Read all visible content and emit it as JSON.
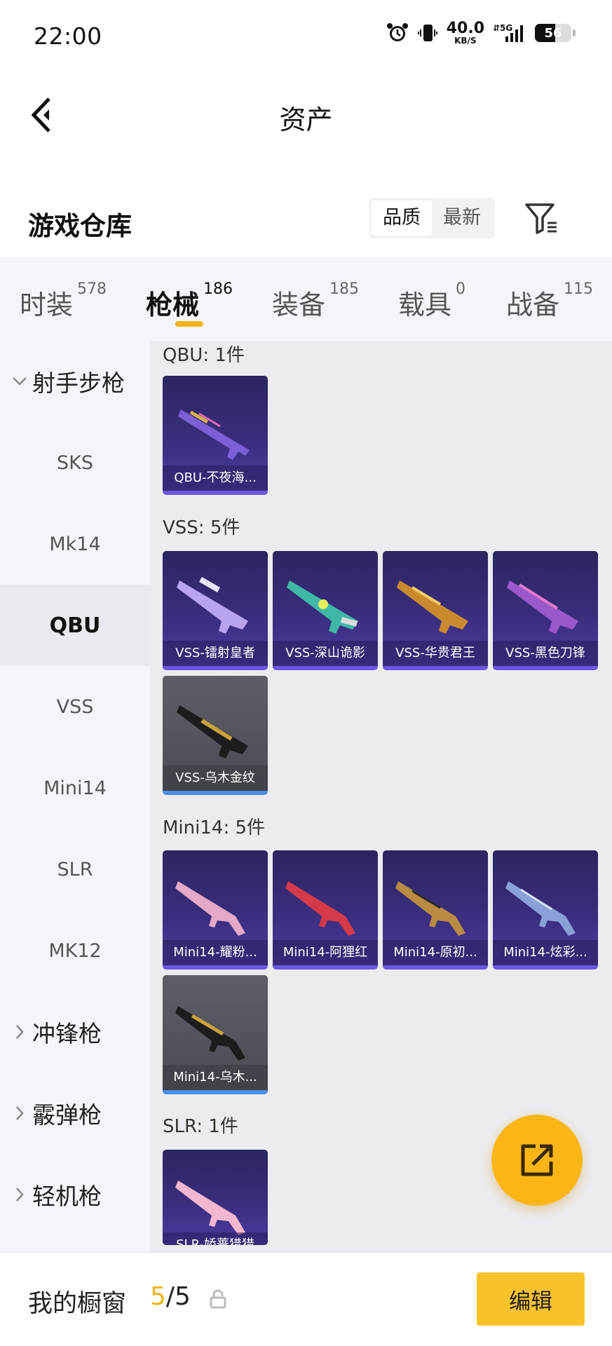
{
  "status_bar": {
    "time": "22:00",
    "net_speed": "40.0",
    "net_unit": "KB/S",
    "network": "5G",
    "battery": "56",
    "battery_level": 0.56
  },
  "nav": {
    "title": "资产"
  },
  "warehouse": {
    "title": "游戏仓库",
    "sort_options": [
      "品质",
      "最新"
    ],
    "active_sort": "品质"
  },
  "tabs": [
    {
      "label": "时装",
      "count": "578"
    },
    {
      "label": "枪械",
      "count": "186"
    },
    {
      "label": "装备",
      "count": "185"
    },
    {
      "label": "载具",
      "count": "0"
    },
    {
      "label": "战备",
      "count": "115"
    }
  ],
  "active_tab": "枪械",
  "sidebar": {
    "group_open": "射手步枪",
    "items": [
      "SKS",
      "Mk14",
      "QBU",
      "VSS",
      "Mini14",
      "SLR",
      "MK12"
    ],
    "active_item": "QBU",
    "groups_closed": [
      "冲锋枪",
      "霰弹枪",
      "轻机枪"
    ]
  },
  "sections": [
    {
      "title": "QBU: 1件",
      "items": [
        "QBU-不夜海..."
      ]
    },
    {
      "title": "VSS: 5件",
      "items": [
        "VSS-镭射皇者",
        "VSS-深山诡影",
        "VSS-华贵君王",
        "VSS-黑色刀锋",
        "VSS-乌木金纹"
      ]
    },
    {
      "title": "Mini14: 5件",
      "items": [
        "Mini14-耀粉...",
        "Mini14-阿狸红",
        "Mini14-原初...",
        "Mini14-炫彩...",
        "Mini14-乌木..."
      ]
    },
    {
      "title": "SLR: 1件",
      "items": [
        "SLR-娇蔷猎猎"
      ]
    }
  ],
  "colors": {
    "accent": "#f3b516",
    "card_purple": "#3a2d7c",
    "card_gray": "#55555c",
    "fab": "#fbb616"
  },
  "bottom": {
    "showcase_label": "我的橱窗",
    "showcase_current": "5",
    "showcase_sep": "/",
    "showcase_total": "5",
    "edit_label": "编辑"
  },
  "icons": {
    "back": "chevron-left-icon",
    "filter": "filter-icon",
    "fab": "share-external-icon",
    "lock": "lock-icon"
  }
}
